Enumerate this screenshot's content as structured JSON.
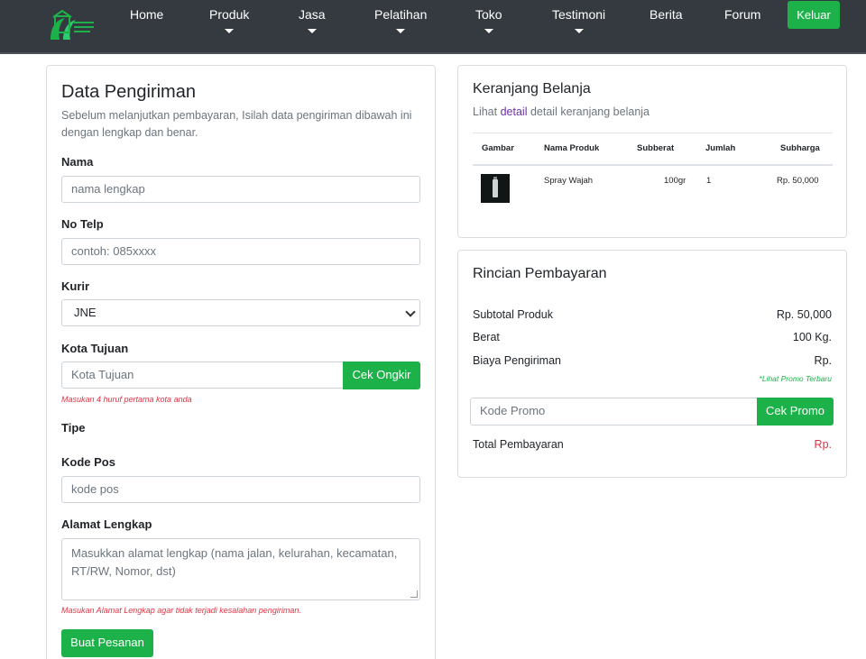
{
  "nav": {
    "items": [
      "Home",
      "Produk",
      "Jasa",
      "Pelatihan",
      "Toko",
      "Testimoni",
      "Berita",
      "Forum"
    ],
    "logout_label": "Keluar"
  },
  "shipping": {
    "title": "Data Pengiriman",
    "subtitle_line1": "Sebelum melanjutkan pembayaran, Isilah data pengiriman dibawah ini",
    "subtitle_line2": "dengan lengkap dan benar.",
    "name_label": "Nama",
    "name_placeholder": "nama lengkap",
    "phone_label": "No Telp",
    "phone_placeholder": "contoh: 085xxxx",
    "courier_label": "Kurir",
    "courier_value": "JNE",
    "city_label": "Kota Tujuan",
    "city_placeholder": "Kota Tujuan",
    "check_shipping_label": "Cek Ongkir",
    "city_hint": "Masukan 4 huruf pertama kota anda",
    "type_label": "Tipe",
    "postal_label": "Kode Pos",
    "postal_placeholder": "kode pos",
    "address_label": "Alamat Lengkap",
    "address_placeholder": "Masukkan alamat lengkap (nama jalan, kelurahan, kecamatan, RT/RW, Nomor, dst)",
    "address_hint": "Masukan Alamat Lengkap agar tidak terjadi kesalahan pengiriman.",
    "submit_label": "Buat Pesanan"
  },
  "cart": {
    "title": "Keranjang Belanja",
    "subtitle_prefix": "Lihat ",
    "subtitle_link": "detail",
    "subtitle_suffix": " detail keranjang belanja",
    "columns": [
      "Gambar",
      "Nama Produk",
      "Subberat",
      "Jumlah",
      "Subharga"
    ],
    "rows": [
      {
        "name": "Spray Wajah",
        "weight": "100gr",
        "qty": "1",
        "price": "Rp. 50,000"
      }
    ]
  },
  "payment": {
    "title": "Rincian Pembayaran",
    "subtotal_label": "Subtotal Produk",
    "subtotal_value": "Rp. 50,000",
    "weight_label": "Berat",
    "weight_value": "100 Kg.",
    "shipping_label": "Biaya Pengiriman",
    "shipping_value": "Rp.",
    "promo_link": "*Lihat Promo Terbaru",
    "promo_placeholder": "Kode Promo",
    "promo_button": "Cek Promo",
    "total_label": "Total Pembayaran",
    "total_value": "Rp."
  },
  "colors": {
    "navbar": "#343a40",
    "accent_green": "#1db249",
    "error_red": "#dc3545"
  }
}
